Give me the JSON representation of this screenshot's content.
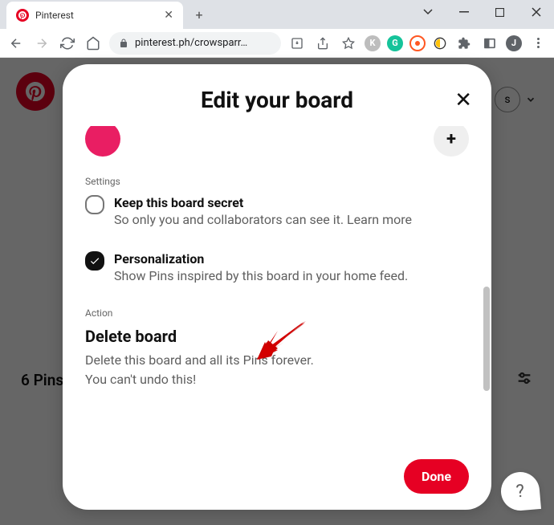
{
  "window": {
    "tab_title": "Pinterest",
    "url": "pinterest.ph/crowsparr…"
  },
  "page": {
    "pin_count": "6 Pins",
    "avatar_letter": "J",
    "s_label": "s"
  },
  "modal": {
    "title": "Edit your board",
    "settings_label": "Settings",
    "secret": {
      "title": "Keep this board secret",
      "desc": "So only you and collaborators can see it. Learn more"
    },
    "personalization": {
      "title": "Personalization",
      "desc": "Show Pins inspired by this board in your home feed."
    },
    "action_label": "Action",
    "delete": {
      "title": "Delete board",
      "desc_line1": "Delete this board and all its Pins forever.",
      "desc_line2": "You can't undo this!"
    },
    "done_label": "Done"
  },
  "help_label": "?"
}
